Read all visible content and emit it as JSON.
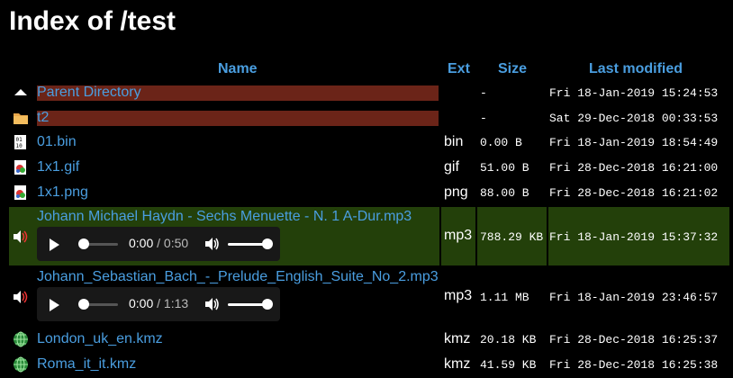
{
  "page": {
    "title": "Index of /test"
  },
  "columns": {
    "name": "Name",
    "ext": "Ext",
    "size": "Size",
    "modified": "Last modified"
  },
  "rows": [
    {
      "icon": "parent-arrow-icon",
      "name": "Parent Directory",
      "ext": "",
      "size": "-",
      "modified": "Fri 18-Jan-2019 15:24:53"
    },
    {
      "icon": "folder-icon",
      "name": "t2",
      "ext": "",
      "size": "-",
      "modified": "Sat 29-Dec-2018 00:33:53"
    },
    {
      "icon": "binary-file-icon",
      "name": "01.bin",
      "ext": "bin",
      "size": "0.00 B",
      "modified": "Fri 18-Jan-2019 18:54:49"
    },
    {
      "icon": "image-file-icon",
      "name": "1x1.gif",
      "ext": "gif",
      "size": "51.00 B",
      "modified": "Fri 28-Dec-2018 16:21:00"
    },
    {
      "icon": "image-file-icon",
      "name": "1x1.png",
      "ext": "png",
      "size": "88.00 B",
      "modified": "Fri 28-Dec-2018 16:21:02"
    },
    {
      "icon": "audio-file-icon",
      "name": "Johann Michael Haydn - Sechs Menuette - N. 1 A-Dur.mp3",
      "ext": "mp3",
      "size": "788.29 KB",
      "modified": "Fri 18-Jan-2019 15:37:32",
      "player": {
        "current": "0:00",
        "duration": "0:50",
        "progress": 0
      }
    },
    {
      "icon": "audio-file-icon",
      "name": "Johann_Sebastian_Bach_-_Prelude_English_Suite_No_2.mp3",
      "ext": "mp3",
      "size": "1.11 MB",
      "modified": "Fri 18-Jan-2019 23:46:57",
      "player": {
        "current": "0:00",
        "duration": "1:13",
        "progress": 0
      }
    },
    {
      "icon": "globe-icon",
      "name": "London_uk_en.kmz",
      "ext": "kmz",
      "size": "20.18 KB",
      "modified": "Fri 28-Dec-2018 16:25:37"
    },
    {
      "icon": "globe-icon",
      "name": "Roma_it_it.kmz",
      "ext": "kmz",
      "size": "41.59 KB",
      "modified": "Fri 28-Dec-2018 16:25:38"
    }
  ],
  "colors": {
    "link": "#4a9ee0",
    "dir_highlight": "#6b2418",
    "row_highlight": "#23400a"
  }
}
